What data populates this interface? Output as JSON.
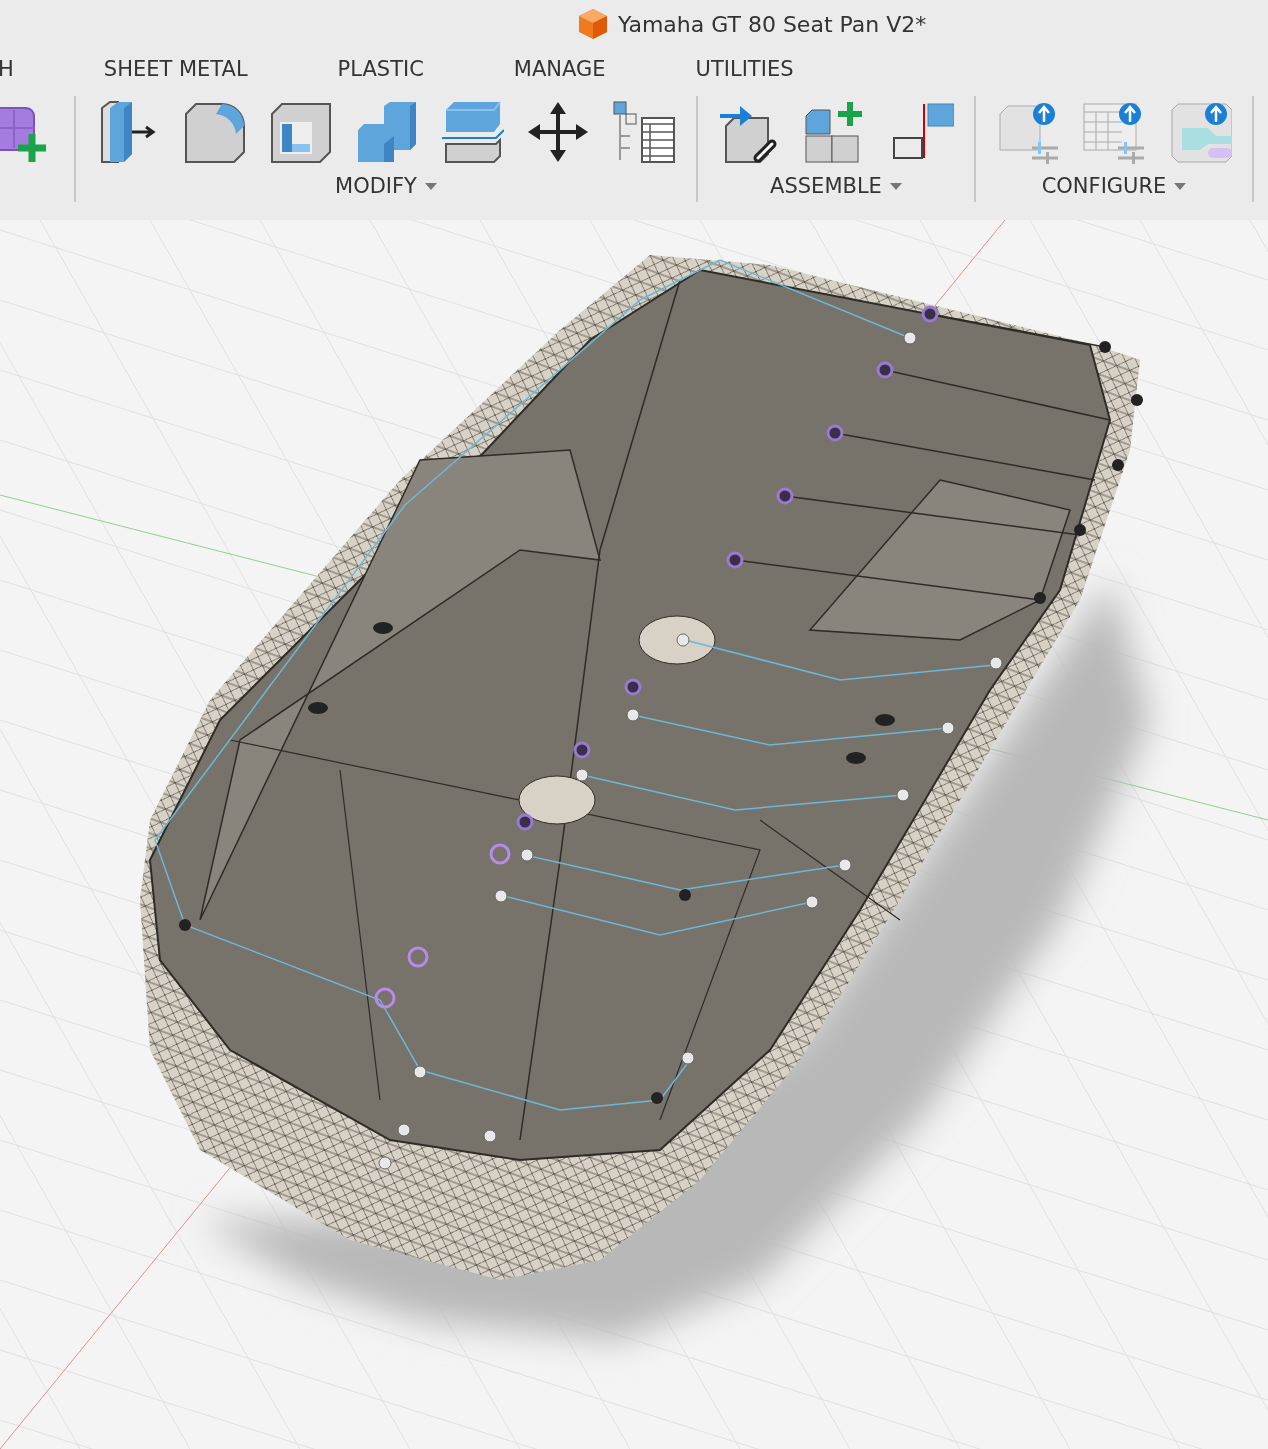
{
  "window": {
    "title": "Yamaha GT 80 Seat Pan V2*"
  },
  "tabs": [
    {
      "label": "H",
      "selected": false
    },
    {
      "label": "SHEET METAL",
      "selected": false
    },
    {
      "label": "PLASTIC",
      "selected": false
    },
    {
      "label": "MANAGE",
      "selected": false
    },
    {
      "label": "UTILITIES",
      "selected": false
    }
  ],
  "toolbar_groups": [
    {
      "tools": [
        {
          "kind": "cube-plus"
        }
      ]
    },
    {
      "label": "MODIFY",
      "tools": [
        {
          "kind": "box-arrow"
        },
        {
          "kind": "fillet-box"
        },
        {
          "kind": "hollow-box"
        },
        {
          "kind": "stacked-boxes"
        },
        {
          "kind": "split-box"
        },
        {
          "kind": "move-arrows"
        },
        {
          "kind": "table-tree"
        }
      ]
    },
    {
      "label": "ASSEMBLE",
      "tools": [
        {
          "kind": "box-link"
        },
        {
          "kind": "box-plus"
        },
        {
          "kind": "flag"
        }
      ]
    },
    {
      "label": "CONFIGURE",
      "tools": [
        {
          "kind": "box-sliders"
        },
        {
          "kind": "grid-sliders"
        },
        {
          "kind": "panel-arrow"
        }
      ]
    }
  ]
}
